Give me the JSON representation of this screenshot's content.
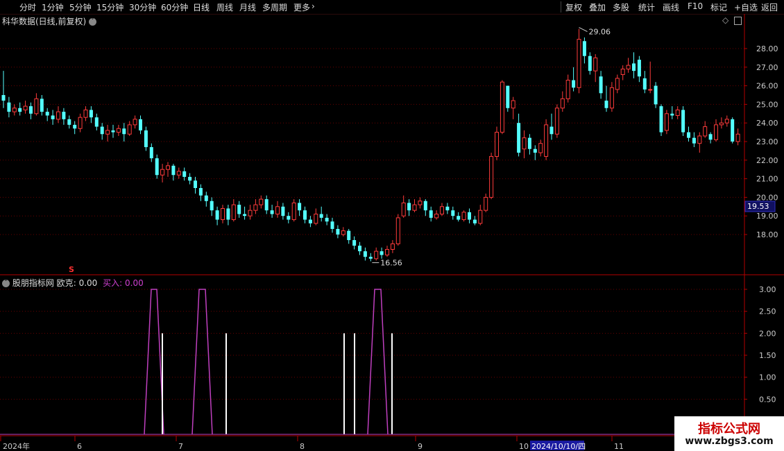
{
  "toolbar": {
    "timeframes": [
      "分时",
      "1分钟",
      "5分钟",
      "15分钟",
      "30分钟",
      "60分钟",
      "日线",
      "周线",
      "月线",
      "多周期",
      "更多"
    ],
    "active": "日线",
    "right": [
      "复权",
      "叠加",
      "多股",
      "统计",
      "画线",
      "F10",
      "标记",
      "+自选",
      "返回"
    ]
  },
  "main": {
    "title": "科华数据(日线,前复权)",
    "price_ticks": [
      "28.00",
      "27.00",
      "26.00",
      "25.00",
      "24.00",
      "23.00",
      "22.00",
      "21.00",
      "20.00",
      "19.00",
      "18.00"
    ],
    "current_price": "19.53",
    "high_label": "29.06",
    "low_label": "16.56",
    "marker_s": "S"
  },
  "indicator": {
    "name": "股朋指标网",
    "ok_label": "欧克",
    "ok_value": "0.00",
    "buy_label": "买入",
    "buy_value": "0.00",
    "ticks": [
      "3.00",
      "2.50",
      "2.00",
      "1.50",
      "1.00",
      "0.50"
    ]
  },
  "time_axis": {
    "labels": [
      "2024年",
      "6",
      "7",
      "8",
      "9",
      "10",
      "11"
    ],
    "cursor_date": "2024/10/10/四"
  },
  "watermark": {
    "line1": "指标公式网",
    "line2": "www.zbgs3.com"
  },
  "colors": {
    "up": "#ff3b3b",
    "down": "#54ffff",
    "axis": "#b40000",
    "purple": "#c040c0"
  },
  "chart_data": {
    "type": "candlestick",
    "ylim": [
      16.0,
      29.5
    ],
    "high": 29.06,
    "low": 16.56,
    "ohlc": [
      [
        25.5,
        25.2,
        26.8,
        24.8
      ],
      [
        25.1,
        24.6,
        25.4,
        24.3
      ],
      [
        24.6,
        24.8,
        25.0,
        24.4
      ],
      [
        24.8,
        24.6,
        25.1,
        24.4
      ],
      [
        24.7,
        24.9,
        25.2,
        24.5
      ],
      [
        24.9,
        24.5,
        25.1,
        24.2
      ],
      [
        24.5,
        25.3,
        25.6,
        24.4
      ],
      [
        25.3,
        24.6,
        25.5,
        24.4
      ],
      [
        24.6,
        24.4,
        24.8,
        24.1
      ],
      [
        24.4,
        24.2,
        24.7,
        23.9
      ],
      [
        24.2,
        24.6,
        24.9,
        24.0
      ],
      [
        24.6,
        24.2,
        24.8,
        23.9
      ],
      [
        24.2,
        23.9,
        24.4,
        23.7
      ],
      [
        23.9,
        23.7,
        24.1,
        23.4
      ],
      [
        23.7,
        24.3,
        24.5,
        23.5
      ],
      [
        24.3,
        24.7,
        24.9,
        24.1
      ],
      [
        24.7,
        24.3,
        24.9,
        24.0
      ],
      [
        24.3,
        23.8,
        24.5,
        23.6
      ],
      [
        23.8,
        23.4,
        24.0,
        23.1
      ],
      [
        23.4,
        23.6,
        23.9,
        23.0
      ],
      [
        23.6,
        23.5,
        23.9,
        23.2
      ],
      [
        23.5,
        23.7,
        23.9,
        23.3
      ],
      [
        23.7,
        23.4,
        24.0,
        23.0
      ],
      [
        23.4,
        23.9,
        24.1,
        23.3
      ],
      [
        23.9,
        24.2,
        24.4,
        23.7
      ],
      [
        24.2,
        23.6,
        24.4,
        23.4
      ],
      [
        23.6,
        22.7,
        23.8,
        22.5
      ],
      [
        22.7,
        22.1,
        22.9,
        21.9
      ],
      [
        22.1,
        21.2,
        22.3,
        21.0
      ],
      [
        21.2,
        21.5,
        21.8,
        20.8
      ],
      [
        21.5,
        21.7,
        21.9,
        21.1
      ],
      [
        21.7,
        21.2,
        21.8,
        20.9
      ],
      [
        21.2,
        21.4,
        21.6,
        21.0
      ],
      [
        21.4,
        21.1,
        21.6,
        20.9
      ],
      [
        21.1,
        20.9,
        21.3,
        20.7
      ],
      [
        20.9,
        20.5,
        21.1,
        20.2
      ],
      [
        20.5,
        20.1,
        20.7,
        19.8
      ],
      [
        20.1,
        19.8,
        20.3,
        19.5
      ],
      [
        19.8,
        19.3,
        20.0,
        19.0
      ],
      [
        19.3,
        18.8,
        19.5,
        18.5
      ],
      [
        18.8,
        19.4,
        19.6,
        18.6
      ],
      [
        19.4,
        18.8,
        19.6,
        18.5
      ],
      [
        18.8,
        19.6,
        19.9,
        18.7
      ],
      [
        19.6,
        19.1,
        19.8,
        18.9
      ],
      [
        19.1,
        19.0,
        19.5,
        18.8
      ],
      [
        19.0,
        19.3,
        19.6,
        18.8
      ],
      [
        19.3,
        19.6,
        19.9,
        19.1
      ],
      [
        19.6,
        19.9,
        20.1,
        19.4
      ],
      [
        19.9,
        19.3,
        20.1,
        19.1
      ],
      [
        19.3,
        19.1,
        19.6,
        18.9
      ],
      [
        19.1,
        19.5,
        19.8,
        18.9
      ],
      [
        19.5,
        19.0,
        19.7,
        18.8
      ],
      [
        19.0,
        18.8,
        19.2,
        18.6
      ],
      [
        18.8,
        19.7,
        19.9,
        18.7
      ],
      [
        19.7,
        19.3,
        19.9,
        19.0
      ],
      [
        19.3,
        18.8,
        19.5,
        18.6
      ],
      [
        18.8,
        18.6,
        19.0,
        18.4
      ],
      [
        18.6,
        19.1,
        19.4,
        18.5
      ],
      [
        19.1,
        18.9,
        19.5,
        18.7
      ],
      [
        18.9,
        18.7,
        19.1,
        18.5
      ],
      [
        18.7,
        18.3,
        18.9,
        18.1
      ],
      [
        18.3,
        18.0,
        18.5,
        17.8
      ],
      [
        18.0,
        18.2,
        18.4,
        17.9
      ],
      [
        18.2,
        17.7,
        18.3,
        17.5
      ],
      [
        17.7,
        17.4,
        17.9,
        17.2
      ],
      [
        17.4,
        17.1,
        17.6,
        16.9
      ],
      [
        17.1,
        16.8,
        17.3,
        16.6
      ],
      [
        16.8,
        16.7,
        17.0,
        16.56
      ],
      [
        16.7,
        17.1,
        17.3,
        16.6
      ],
      [
        17.1,
        16.9,
        17.3,
        16.7
      ],
      [
        16.9,
        17.2,
        17.4,
        16.8
      ],
      [
        17.2,
        17.5,
        17.7,
        17.0
      ],
      [
        17.5,
        18.9,
        19.1,
        17.4
      ],
      [
        19.0,
        19.7,
        20.1,
        18.9
      ],
      [
        19.7,
        19.3,
        19.9,
        19.0
      ],
      [
        19.3,
        19.6,
        19.9,
        19.2
      ],
      [
        19.6,
        19.8,
        20.0,
        19.4
      ],
      [
        19.8,
        19.3,
        19.9,
        19.0
      ],
      [
        19.3,
        18.9,
        19.5,
        18.7
      ],
      [
        18.9,
        19.1,
        19.3,
        18.8
      ],
      [
        19.1,
        19.5,
        19.7,
        19.0
      ],
      [
        19.5,
        19.3,
        19.7,
        19.1
      ],
      [
        19.3,
        19.0,
        19.5,
        18.8
      ],
      [
        19.0,
        18.8,
        19.2,
        18.7
      ],
      [
        18.8,
        19.2,
        19.3,
        18.7
      ],
      [
        19.2,
        18.8,
        19.4,
        18.6
      ],
      [
        18.8,
        18.6,
        19.0,
        18.5
      ],
      [
        18.6,
        19.3,
        19.6,
        18.5
      ],
      [
        19.3,
        20.0,
        20.2,
        19.2
      ],
      [
        20.0,
        22.2,
        22.4,
        19.9
      ],
      [
        22.2,
        23.5,
        23.8,
        22.0
      ],
      [
        23.5,
        26.2,
        26.3,
        23.4
      ],
      [
        26.0,
        24.8,
        26.0,
        24.6
      ],
      [
        24.8,
        25.2,
        25.4,
        24.2
      ],
      [
        24.0,
        22.4,
        24.5,
        22.2
      ],
      [
        22.6,
        23.2,
        23.6,
        22.1
      ],
      [
        23.2,
        22.6,
        23.4,
        22.3
      ],
      [
        22.6,
        22.4,
        22.8,
        22.0
      ],
      [
        22.4,
        22.9,
        23.1,
        22.2
      ],
      [
        22.2,
        23.9,
        24.2,
        22.0
      ],
      [
        23.8,
        23.4,
        24.5,
        23.1
      ],
      [
        23.4,
        24.8,
        25.0,
        23.2
      ],
      [
        24.8,
        25.3,
        25.7,
        24.6
      ],
      [
        25.3,
        26.3,
        26.6,
        25.1
      ],
      [
        26.3,
        25.9,
        27.0,
        25.7
      ],
      [
        25.9,
        28.5,
        29.06,
        25.6
      ],
      [
        28.4,
        27.6,
        28.6,
        27.2
      ],
      [
        27.6,
        26.8,
        27.8,
        26.6
      ],
      [
        26.8,
        27.5,
        27.7,
        26.2
      ],
      [
        26.5,
        25.6,
        26.8,
        25.3
      ],
      [
        25.2,
        24.8,
        26.0,
        24.6
      ],
      [
        24.8,
        25.9,
        26.2,
        24.6
      ],
      [
        25.8,
        26.4,
        26.6,
        25.6
      ],
      [
        26.6,
        26.9,
        27.1,
        26.3
      ],
      [
        26.9,
        27.1,
        27.5,
        26.7
      ],
      [
        27.2,
        26.8,
        27.8,
        26.4
      ],
      [
        27.4,
        26.5,
        27.6,
        26.2
      ],
      [
        26.4,
        25.8,
        26.8,
        25.6
      ],
      [
        25.8,
        25.8,
        27.3,
        25.6
      ],
      [
        26.0,
        25.0,
        26.2,
        24.8
      ],
      [
        24.9,
        23.5,
        25.0,
        23.3
      ],
      [
        23.6,
        24.5,
        24.7,
        23.4
      ],
      [
        24.5,
        24.4,
        24.9,
        24.2
      ],
      [
        24.4,
        24.7,
        24.9,
        24.2
      ],
      [
        24.7,
        23.5,
        24.9,
        23.3
      ],
      [
        23.5,
        23.2,
        23.8,
        23.0
      ],
      [
        23.2,
        22.9,
        23.5,
        22.7
      ],
      [
        22.9,
        23.3,
        23.5,
        22.4
      ],
      [
        23.3,
        23.8,
        24.1,
        23.2
      ],
      [
        23.4,
        23.1,
        23.5,
        22.9
      ],
      [
        23.1,
        23.9,
        24.2,
        23.0
      ],
      [
        23.9,
        24.0,
        24.3,
        23.7
      ],
      [
        24.0,
        24.2,
        24.4,
        23.8
      ],
      [
        24.2,
        23.0,
        24.3,
        22.9
      ],
      [
        23.0,
        23.4,
        23.7,
        22.8
      ]
    ],
    "indicator": {
      "ok_pulses": [
        [
          208,
          236
        ],
        [
          277,
          306
        ],
        [
          530,
          559
        ]
      ],
      "ok_peak": 3.0,
      "buy_bars": [
        234,
        326,
        496,
        511,
        565
      ],
      "buy_value": 2.0
    }
  }
}
